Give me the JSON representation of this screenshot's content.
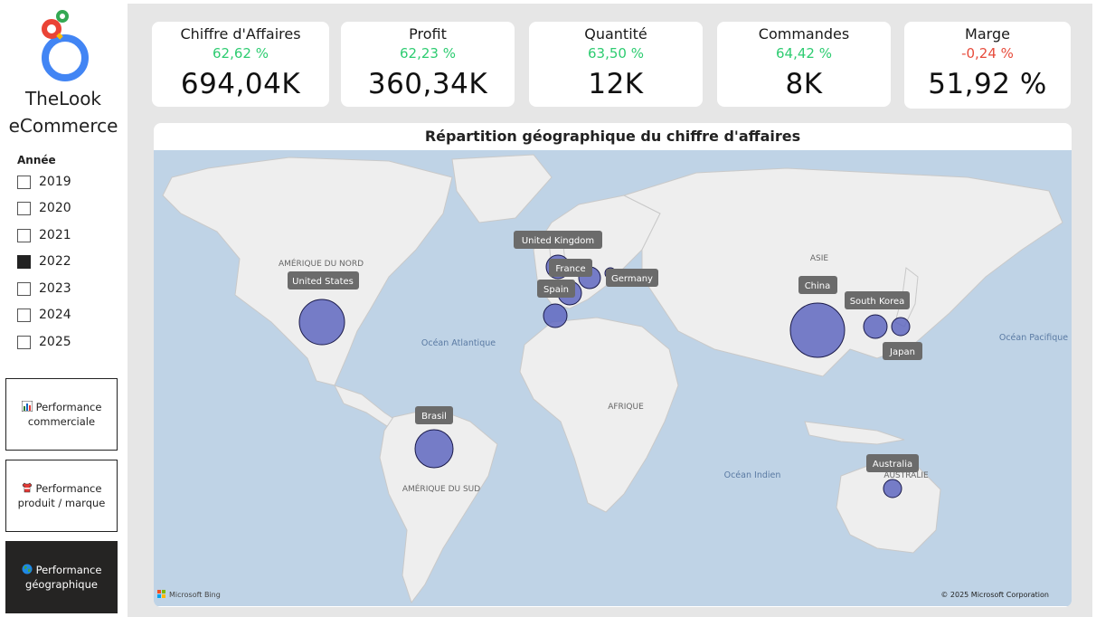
{
  "brand": {
    "line1": "TheLook",
    "line2": "eCommerce"
  },
  "year_filter": {
    "title": "Année",
    "years": [
      {
        "label": "2019",
        "checked": false
      },
      {
        "label": "2020",
        "checked": false
      },
      {
        "label": "2021",
        "checked": false
      },
      {
        "label": "2022",
        "checked": true
      },
      {
        "label": "2023",
        "checked": false
      },
      {
        "label": "2024",
        "checked": false
      },
      {
        "label": "2025",
        "checked": false
      }
    ]
  },
  "nav": [
    {
      "line1": "Performance",
      "line2": "commerciale",
      "icon": "bar-chart-icon",
      "active": false
    },
    {
      "line1": "Performance",
      "line2": "produit / marque",
      "icon": "tshirt-icon",
      "active": false
    },
    {
      "line1": "Performance",
      "line2": "géographique",
      "icon": "globe-icon",
      "active": true
    }
  ],
  "kpis": [
    {
      "title": "Chiffre d'Affaires",
      "pct": "62,62 %",
      "value": "694,04K",
      "trend": "positive"
    },
    {
      "title": "Profit",
      "pct": "62,23 %",
      "value": "360,34K",
      "trend": "positive"
    },
    {
      "title": "Quantité",
      "pct": "63,50 %",
      "value": "12K",
      "trend": "positive"
    },
    {
      "title": "Commandes",
      "pct": "64,42 %",
      "value": "8K",
      "trend": "positive"
    },
    {
      "title": "Marge",
      "pct": "-0,24 %",
      "value": "51,92 %",
      "trend": "negative"
    }
  ],
  "map": {
    "title": "Répartition géographique du chiffre d'affaires",
    "region_labels": {
      "north_america": "AMÉRIQUE DU NORD",
      "south_america": "AMÉRIQUE DU SUD",
      "africa": "AFRIQUE",
      "asia": "ASIE",
      "australia": "AUSTRALIE",
      "atlantic": "Océan Atlantique",
      "indian": "Océan Indien",
      "pacific": "Océan Pacifique"
    },
    "countries": [
      "United States",
      "Brasil",
      "United Kingdom",
      "France",
      "Germany",
      "Spain",
      "China",
      "South Korea",
      "Japan",
      "Australia"
    ],
    "footer_left": "Microsoft Bing",
    "footer_right": "© 2025 Microsoft Corporation",
    "bubble_color": "#5f67c0",
    "ocean_color": "#bfd3e6",
    "land_color": "#eeeeee"
  },
  "colors": {
    "positive": "#2ecc71",
    "negative": "#e74c3c",
    "active_nav": "#252423"
  }
}
